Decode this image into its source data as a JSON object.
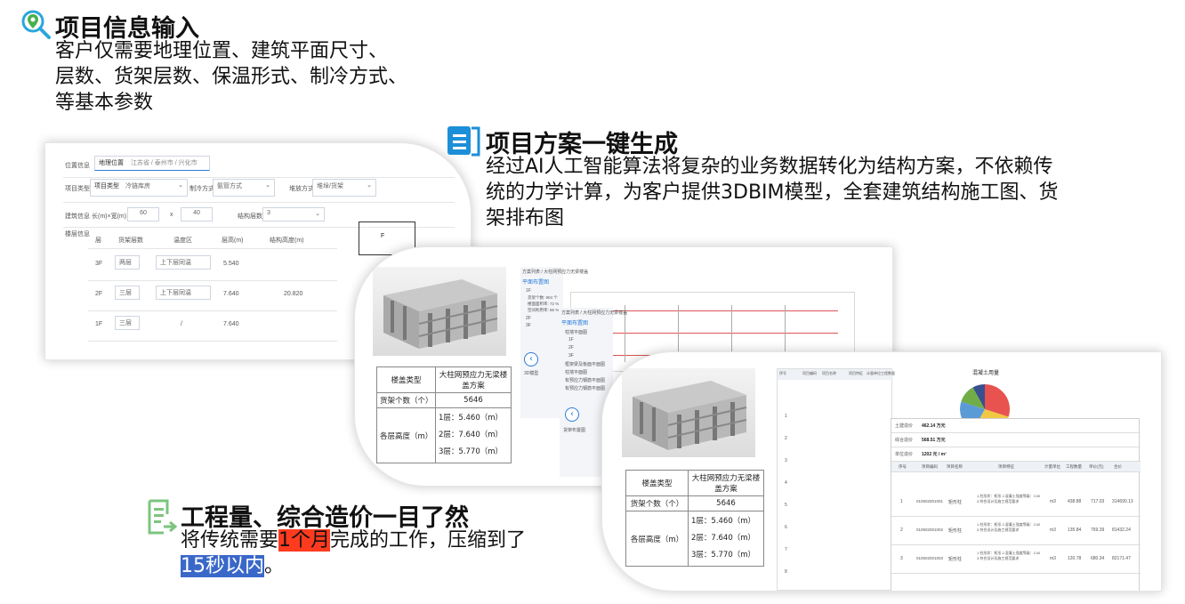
{
  "sections": {
    "input": {
      "title": "项目信息输入",
      "desc": [
        "客户仅需要地理位置、建筑平面尺寸、",
        "层数、货架层数、保温形式、制冷方式、",
        "等基本参数"
      ]
    },
    "generate": {
      "title": "项目方案一键生成",
      "desc": [
        "经过AI人工智能算法将复杂的业务数据转化为结构方案，不依赖传",
        "统的力学计算，为客户提供3DBIM模型，全套建筑结构施工图、货",
        "架排布图"
      ]
    },
    "cost": {
      "title": "工程量、综合造价一目了然",
      "desc_pre": "将传统需要",
      "desc_hl1": "1个月",
      "desc_mid": "完成的工作，压缩到了",
      "desc_hl2": "15秒以内",
      "desc_post": "。"
    }
  },
  "form_card": {
    "labels": [
      "位置信息",
      "项目类型",
      "建筑信息",
      "楼层信息"
    ],
    "location_label": "地理位置",
    "location_value": "江苏省 / 泰州市 / 兴化市",
    "project_type_label": "项目类型",
    "project_type_value": "冷链库房",
    "cooling_label": "制冷方式",
    "cooling_value": "氨管方式",
    "insulation_label": "堆放方式",
    "insulation_value": "堆垛/货架",
    "size_label": "长(m)×宽(m)",
    "length": "60",
    "times": "x",
    "width": "40",
    "structure_label": "结构层数",
    "structure_value": "3",
    "floor_headers": [
      "层",
      "货架层数",
      "温度区",
      "层高(m)",
      "结构高度(m)"
    ],
    "floors": [
      {
        "floor": "3F",
        "rack": "两层",
        "temp": "上下层同温",
        "height": "5.540",
        "struct": ""
      },
      {
        "floor": "2F",
        "rack": "三层",
        "temp": "上下层同温",
        "height": "7.640",
        "struct": "20.820"
      },
      {
        "floor": "1F",
        "rack": "三层",
        "temp": "/",
        "height": "7.640",
        "struct": ""
      }
    ],
    "plan_label": "F"
  },
  "scheme_card": {
    "breadcrumb": "方案列表 / 大柱网预应力无梁楼盖",
    "tree_title": "平面布置图",
    "tree_items": [
      "1F",
      "货架个数: 904 个",
      "楼面面积率: 72 %",
      "空间利用率: 56 %",
      "2F",
      "3F"
    ],
    "nav_label": "3D模型",
    "sub_breadcrumb": "方案列表 / 大柱网预应力无梁楼盖",
    "sub_tree_title": "平面布置图",
    "sub_tree_items": [
      "柱墙平面图",
      "1F",
      "2F",
      "3F",
      "框架梁及板面平面图",
      "柱墙平面图",
      "有预应力钢筋平面图",
      "有预应力钢筋平面图"
    ],
    "sub_nav_label": "货架布置图"
  },
  "spec_table": {
    "type_label": "楼盖类型",
    "type_value": "大柱网预应力无梁楼盖方案",
    "rack_label": "货架个数（个）",
    "rack_value": "5646",
    "height_label": "各层高度（m）",
    "heights": [
      "1层：5.460（m）",
      "2层：7.640（m）",
      "3层：5.770（m）"
    ]
  },
  "cost_card": {
    "chart_title": "混凝土用量",
    "summary": [
      {
        "label": "土建造价",
        "value": "462.14 万元"
      },
      {
        "label": "综合造价",
        "value": "568.51 万元"
      },
      {
        "label": "单位造价",
        "value": "1202 元 / m²"
      }
    ],
    "headers": [
      "序号",
      "项目编码",
      "项目名称",
      "项目特征",
      "计量单位",
      "工程数量",
      "单价(元)",
      "合价"
    ],
    "rows": [
      {
        "no": "1",
        "code": "010502001001",
        "name": "矩形柱",
        "feature": "1.柱形状：矩形 2.混凝土强度等级：C40 3.符合设计及施工规范要求",
        "unit": "m3",
        "qty": "438.88",
        "price": "717.03",
        "total": "314690.13"
      },
      {
        "no": "2",
        "code": "010502001002",
        "name": "矩形柱",
        "feature": "1.柱形状：矩形 2.混凝土强度等级：C40 3.符合设计及施工规范要求",
        "unit": "m3",
        "qty": "135.84",
        "price": "769.39",
        "total": "81432.24"
      },
      {
        "no": "3",
        "code": "010502001003",
        "name": "矩形柱",
        "feature": "1.柱形状：矩形 2.混凝土强度等级：C40 3.符合设计及施工规范要求",
        "unit": "m3",
        "qty": "120.78",
        "price": "680.34",
        "total": "82171.47"
      }
    ],
    "left_rows": [
      "1",
      "2",
      "3",
      "4",
      "5",
      "6",
      "7",
      "8"
    ],
    "left_headers": [
      "序号",
      "项目编码",
      "项目名称",
      "项目特征",
      "计量单位",
      "工程数量"
    ],
    "pie": [
      {
        "value": 0.3,
        "color": "#e8534f"
      },
      {
        "value": 0.28,
        "color": "#f2c744"
      },
      {
        "value": 0.22,
        "color": "#5b9bd5"
      },
      {
        "value": 0.12,
        "color": "#70ad47"
      },
      {
        "value": 0.08,
        "color": "#3a4f8f"
      }
    ]
  },
  "colors": {
    "accent_blue": "#1d8fd8",
    "accent_green": "#4caf50",
    "highlight_red": "#ff3b1f",
    "highlight_blue": "#3a68c9"
  }
}
